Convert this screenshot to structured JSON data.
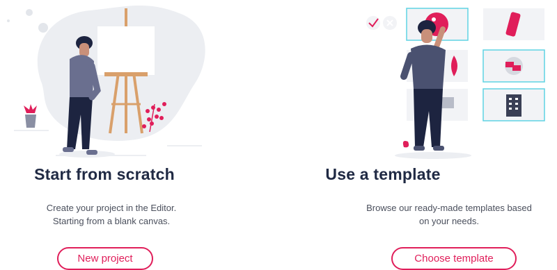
{
  "scratch": {
    "title": "Start from scratch",
    "desc_line1": "Create your project in the Editor.",
    "desc_line2": "Starting from a blank canvas.",
    "button_label": "New project",
    "illustration_icon": "artist-easel-illustration"
  },
  "template": {
    "title": "Use a template",
    "desc_line1": "Browse our ready-made templates based",
    "desc_line2": "on your needs.",
    "button_label": "Choose template",
    "illustration_icon": "template-selection-illustration"
  },
  "colors": {
    "accent": "#e01e5a",
    "heading": "#202a44",
    "text": "#4a4f5c",
    "frame": "#5ed3e3",
    "blob": "#eceef2"
  }
}
